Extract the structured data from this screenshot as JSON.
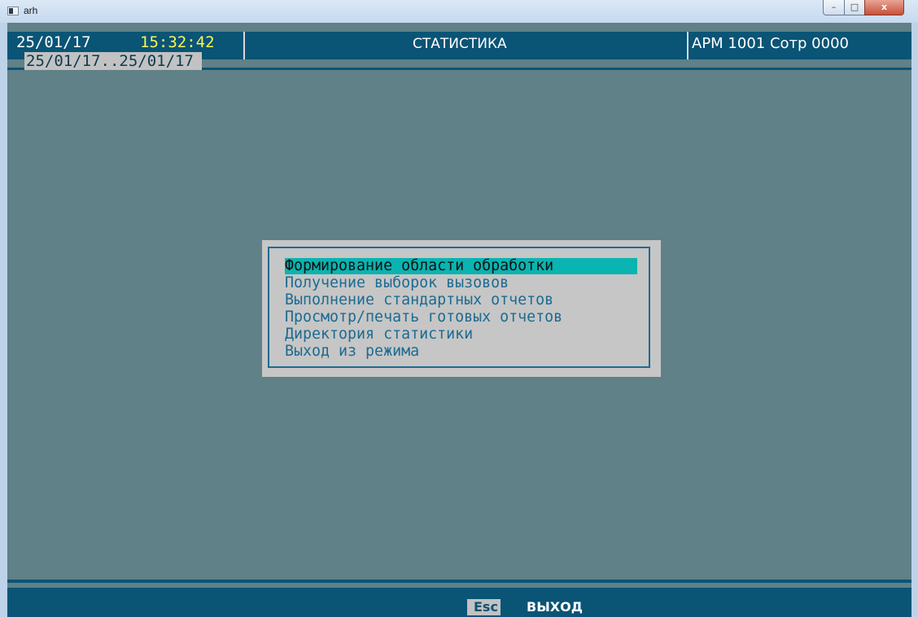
{
  "window": {
    "title": "arh",
    "controls": {
      "minimize": "–",
      "maximize": "□",
      "close": "x"
    }
  },
  "header": {
    "date": "25/01/17",
    "time": "15:32:42",
    "date_range": "25/01/17..25/01/17",
    "title": "СТАТИСТИКА",
    "workstation": "АРМ 1001 Сотр 0000"
  },
  "menu": {
    "items": [
      {
        "label": "Формирование области обработки",
        "selected": true
      },
      {
        "label": "Получение выборок вызовов",
        "selected": false
      },
      {
        "label": "Выполнение стандартных отчетов",
        "selected": false
      },
      {
        "label": "Просмотр/печать готовых отчетов",
        "selected": false
      },
      {
        "label": "Директория статистики",
        "selected": false
      },
      {
        "label": "Выход из режима",
        "selected": false
      }
    ]
  },
  "footer": {
    "key": "Esc",
    "action": "ВЫХОД"
  },
  "colors": {
    "console_bg": "#5f8187",
    "bar_blue": "#0a5476",
    "menu_bg": "#c6c6c6",
    "menu_text": "#1c6b91",
    "selection": "#09b4b1",
    "time_yellow": "#f6f655"
  }
}
